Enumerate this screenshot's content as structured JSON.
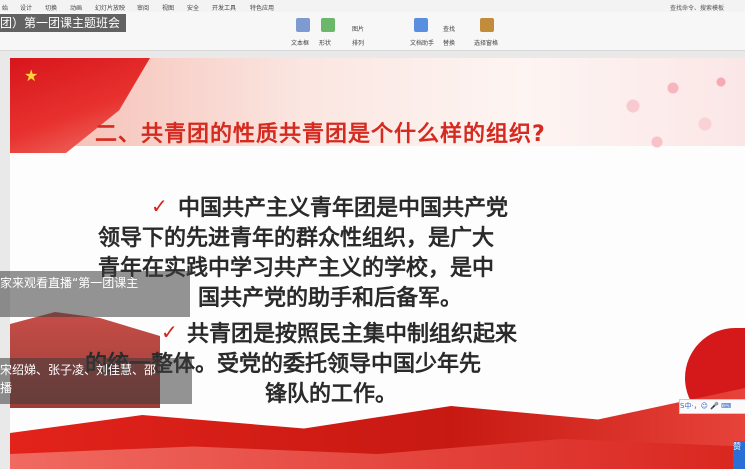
{
  "menu_tabs": [
    "始",
    "设计",
    "切换",
    "动画",
    "幻灯片放映",
    "审阅",
    "视图",
    "安全",
    "开发工具",
    "特色应用"
  ],
  "search_hint": "查找命令、搜索模板",
  "window_title": "团）第一团课主题班会",
  "ribbon": {
    "text_box": "文本框",
    "shape": "形状",
    "arrange": "排列",
    "image": "图片",
    "find": "查找",
    "replace": "替换",
    "doc_assistant": "文档助手",
    "select_pane": "选择窗格"
  },
  "slide": {
    "title": "二、共青团的性质共青团是个什么样的组织?",
    "para1_lines": [
      "中国共产主义青年团是中国共产党",
      "领导下的先进青年的群众性组织，是广大",
      "青年在实践中学习共产主义的学校，是中",
      "国共产党的助手和后备军。"
    ],
    "para2_lines": [
      "共青团是按照民主集中制组织起来",
      "的统一整体。受党的委托领导中国少年先",
      "锋队的工作。"
    ],
    "check_mark": "✓"
  },
  "overlays": {
    "comment1": "家来观看直播“第一团课主",
    "comment2_line1": "宋绍娣、张子凌、刘佳慧、邵",
    "comment2_line2": "播"
  },
  "ime_bar": "S中·，☺ 🎤 ⌨",
  "corner_button": "赞"
}
